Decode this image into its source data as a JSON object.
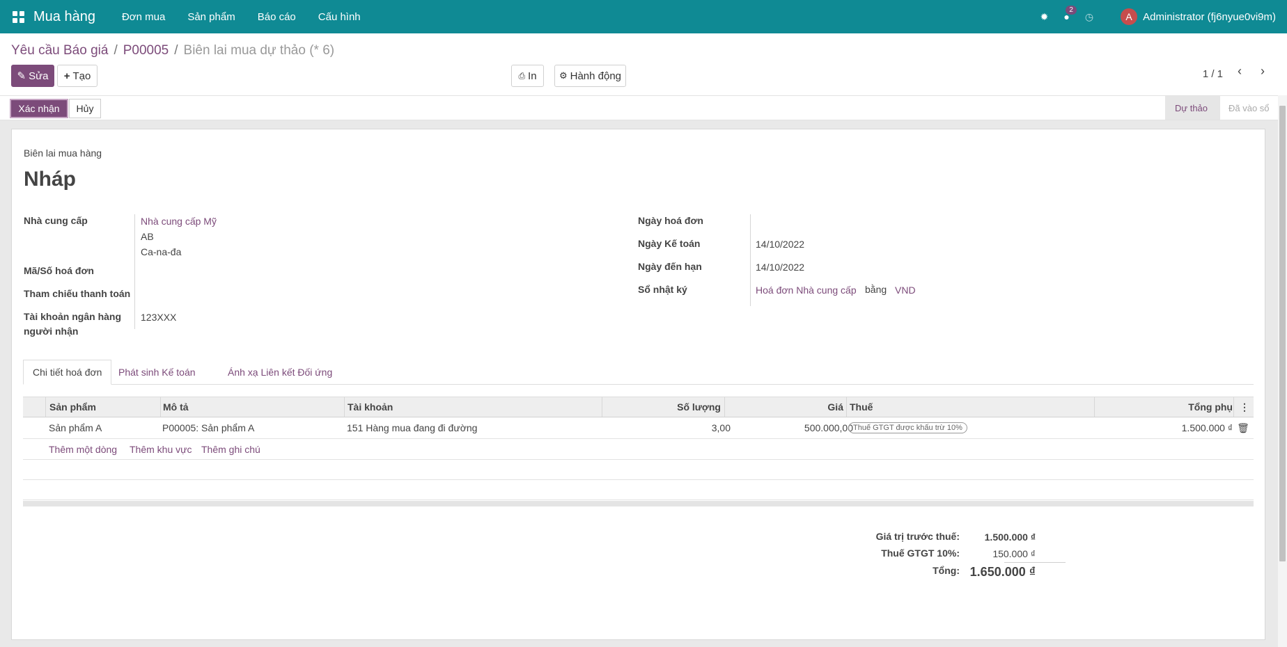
{
  "topbar": {
    "app_name": "Mua hàng",
    "menu": [
      "Đơn mua",
      "Sản phẩm",
      "Báo cáo",
      "Cấu hình"
    ],
    "chat_count": "2",
    "avatar_letter": "A",
    "user": "Administrator (fj6nyue0vi9m)",
    "accent": "#0f8a94"
  },
  "breadcrumb": {
    "root": "Yêu cầu Báo giá",
    "parent": "P00005",
    "current": "Biên lai mua dự thảo (* 6)",
    "separator": "/"
  },
  "buttons": {
    "edit": "Sửa",
    "create": "Tạo",
    "print": "In",
    "action": "Hành động",
    "confirm": "Xác nhận",
    "cancel": "Hủy"
  },
  "pager": "1 / 1",
  "stages": {
    "current": "Dự thảo",
    "next": "Đã vào sổ"
  },
  "sheet": {
    "doc_type": "Biên lai mua hàng",
    "title": "Nháp",
    "left_fields": {
      "vendor_label": "Nhà cung cấp",
      "vendor_name": "Nhà cung cấp Mỹ",
      "vendor_line2": "AB",
      "vendor_line3": "Ca-na-đa",
      "invoice_ref_label": "Mã/Số hoá đơn",
      "payment_ref_label": "Tham chiếu thanh toán",
      "bank_label_1": "Tài khoản ngân hàng",
      "bank_label_2": "người nhận",
      "bank_value": "123XXX"
    },
    "right_fields": {
      "invoice_date_label": "Ngày hoá đơn",
      "accounting_date_label": "Ngày Kế toán",
      "accounting_date": "14/10/2022",
      "due_date_label": "Ngày đến hạn",
      "due_date": "14/10/2022",
      "journal_label": "Sổ nhật ký",
      "journal": "Hoá đơn Nhà cung cấp",
      "in_word": "bằng",
      "currency": "VND"
    }
  },
  "tabs": [
    "Chi tiết hoá đơn",
    "Phát sinh Kế toán",
    "Ánh xạ Liên kết Đối ứng"
  ],
  "table": {
    "headers": [
      "Sản phẩm",
      "Mô tả",
      "Tài khoản",
      "Số lượng",
      "Giá",
      "Thuế",
      "Tổng phụ"
    ],
    "rows": [
      {
        "product": "Sản phẩm A",
        "description": "P00005: Sản phẩm A",
        "account": "151 Hàng mua đang đi đường",
        "quantity": "3,00",
        "price": "500.000,00",
        "tax": "Thuế GTGT được khấu trừ 10%",
        "subtotal": "1.500.000 ₫"
      }
    ],
    "add_links": [
      "Thêm một dòng",
      "Thêm khu vực",
      "Thêm ghi chú"
    ]
  },
  "totals": {
    "untaxed_label": "Giá trị trước thuế:",
    "untaxed": "1.500.000 ₫",
    "tax_label": "Thuế GTGT 10%:",
    "tax": "150.000 ₫",
    "total_label": "Tổng:",
    "total": "1.650.000 ₫"
  }
}
